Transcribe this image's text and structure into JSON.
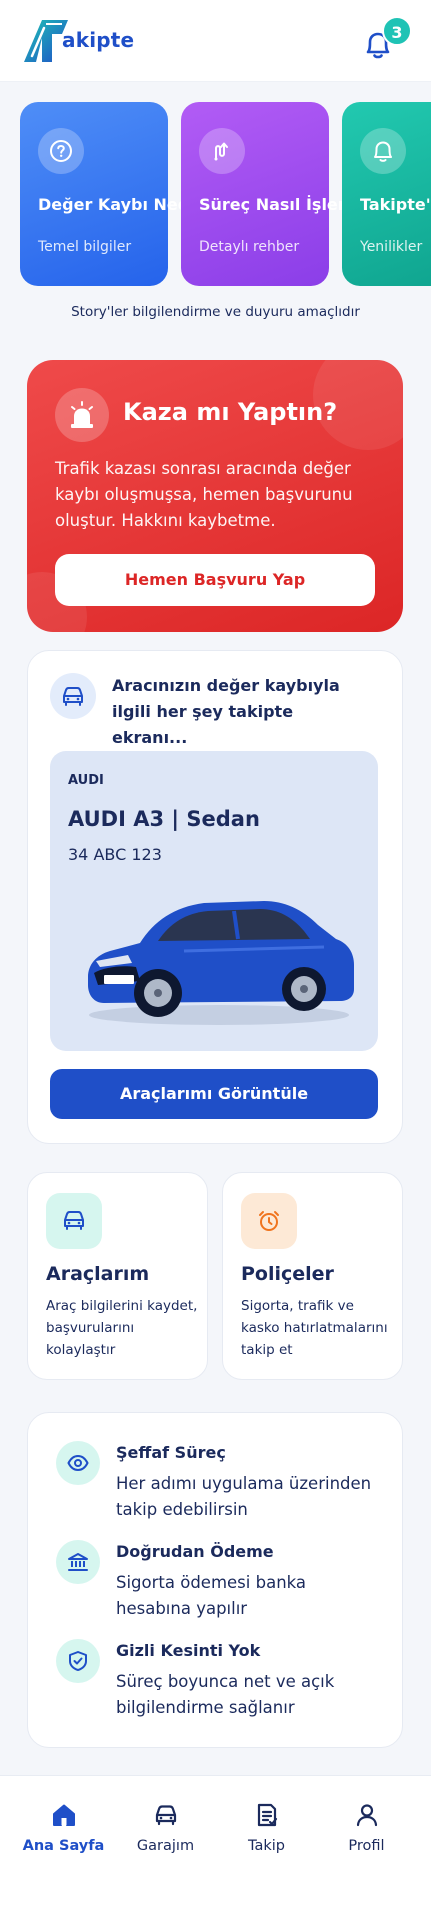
{
  "header": {
    "logo_text": "akipte",
    "notification_count": "3"
  },
  "stories": [
    {
      "title": "Değer Kaybı Nedir?",
      "subtitle": "Temel bilgiler",
      "icon": "question-icon",
      "color": "#3b7bf0"
    },
    {
      "title": "Süreç Nasıl İşler?",
      "subtitle": "Detaylı rehber",
      "icon": "route-icon",
      "color": "#a14ef0"
    },
    {
      "title": "Takipte'den Duyurular",
      "subtitle": "Yenilikler",
      "icon": "bell-icon",
      "color": "#1bb8a1"
    }
  ],
  "stories_note": "Story'ler bilgilendirme ve duyuru amaçlıdır",
  "accident": {
    "title": "Kaza mı Yaptın?",
    "description": "Trafik kazası sonrası aracında değer kaybı oluşmuşsa, hemen başvurunu oluştur. Hakkını kaybetme.",
    "button": "Hemen Başvuru Yap",
    "color": "#e53535"
  },
  "garage": {
    "intro": "Aracınızın değer kaybıyla ilgili her şey takipte ekranı...",
    "vehicle": {
      "brand": "AUDI",
      "model": "AUDI A3 | Sedan",
      "plate": "34 ABC 123"
    },
    "button": "Araçlarımı Görüntüle"
  },
  "features": [
    {
      "title": "Araçlarım",
      "description": "Araç bilgilerini kaydet, başvurularını kolaylaştır",
      "icon": "car-icon"
    },
    {
      "title": "Poliçeler",
      "description": "Sigorta, trafik ve kasko hatırlatmalarını takip et",
      "icon": "alarm-clock-icon"
    }
  ],
  "trust": [
    {
      "title": "Şeffaf Süreç",
      "description": "Her adımı uygulama üzerinden takip edebilirsin",
      "icon": "eye-icon"
    },
    {
      "title": "Doğrudan Ödeme",
      "description": "Sigorta ödemesi banka hesabına yapılır",
      "icon": "bank-icon"
    },
    {
      "title": "Gizli Kesinti Yok",
      "description": "Süreç boyunca net ve açık bilgilendirme sağlanır",
      "icon": "shield-check-icon"
    }
  ],
  "tabbar": [
    {
      "label": "Ana Sayfa",
      "icon": "home-icon",
      "active": true
    },
    {
      "label": "Garajım",
      "icon": "car-icon",
      "active": false
    },
    {
      "label": "Takip",
      "icon": "document-icon",
      "active": false
    },
    {
      "label": "Profil",
      "icon": "user-icon",
      "active": false
    }
  ],
  "colors": {
    "primary": "#1f4fc8",
    "accent": "#1fc3b5",
    "text": "#1b2a5c"
  }
}
